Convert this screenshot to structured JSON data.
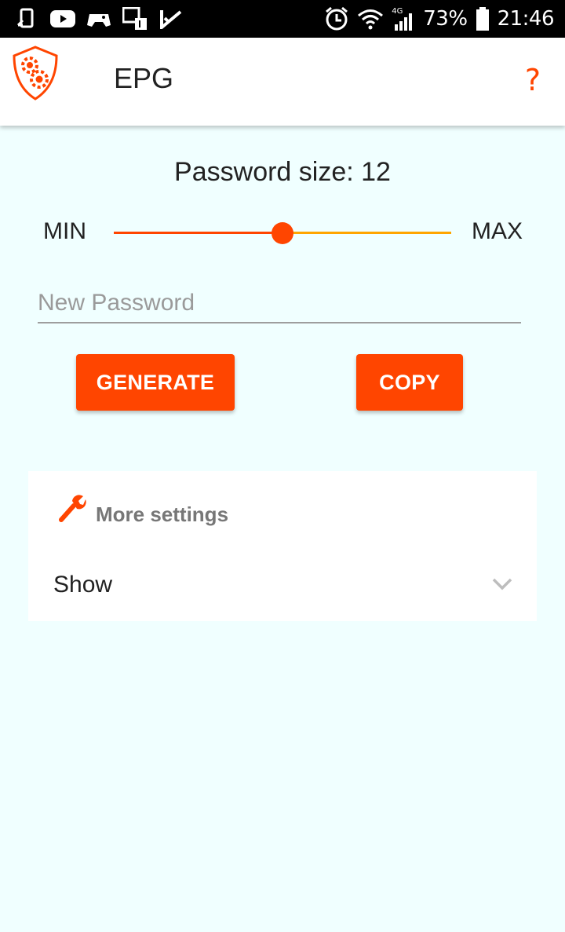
{
  "status_bar": {
    "icons": [
      "phone-sync-icon",
      "youtube-icon",
      "game-controller-icon",
      "notification-badge-icon",
      "checkmark-app-icon"
    ],
    "network": "4G",
    "battery": "73%",
    "time": "21:46"
  },
  "app_bar": {
    "title": "EPG",
    "help_label": "?"
  },
  "password_size": {
    "label": "Password size: 12",
    "value": 12,
    "min_label": "MIN",
    "max_label": "MAX",
    "slider_fraction": 0.5
  },
  "password_field": {
    "placeholder": "New Password",
    "value": ""
  },
  "buttons": {
    "generate": "GENERATE",
    "copy": "COPY"
  },
  "settings": {
    "title": "More settings",
    "show_label": "Show"
  },
  "colors": {
    "accent": "#ff4500",
    "track_rest": "#ffa500",
    "background": "#f0ffff"
  }
}
